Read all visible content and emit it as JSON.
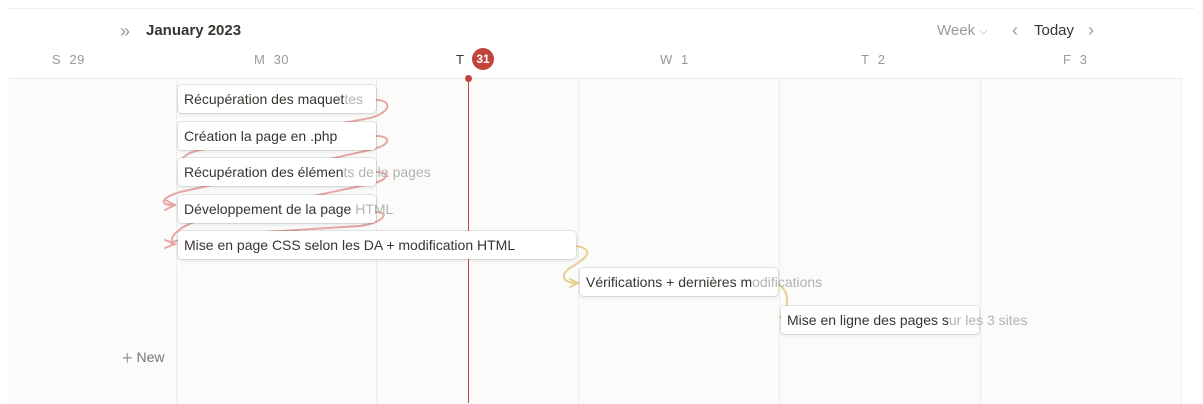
{
  "header": {
    "month_title": "January 2023",
    "view_select": "Week",
    "today_label": "Today"
  },
  "days": [
    {
      "letter": "S",
      "num": "29"
    },
    {
      "letter": "M",
      "num": "30"
    },
    {
      "letter": "T",
      "num": "31"
    },
    {
      "letter": "W",
      "num": "1"
    },
    {
      "letter": "T",
      "num": "2"
    },
    {
      "letter": "F",
      "num": "3"
    }
  ],
  "tasks": [
    {
      "title_visible": "Récupération des maquet",
      "title_overflow": "tes"
    },
    {
      "title_visible": "Création la page en .php",
      "title_overflow": ""
    },
    {
      "title_visible": "Récupération des élémen",
      "title_overflow": "ts de la pages"
    },
    {
      "title_visible": "Développement de la page",
      "title_overflow": " HTML"
    },
    {
      "title_visible": "Mise en page CSS selon les DA + modification HTML",
      "title_overflow": ""
    },
    {
      "title_visible": "Vérifications + dernières m",
      "title_overflow": "odifications"
    },
    {
      "title_visible": "Mise en ligne des pages s",
      "title_overflow": "ur les 3 sites"
    }
  ],
  "new_label": "New",
  "colors": {
    "accent_today": "#c0443c",
    "dependency_red": "#e6a8a3",
    "dependency_yellow": "#e8cf8f"
  }
}
